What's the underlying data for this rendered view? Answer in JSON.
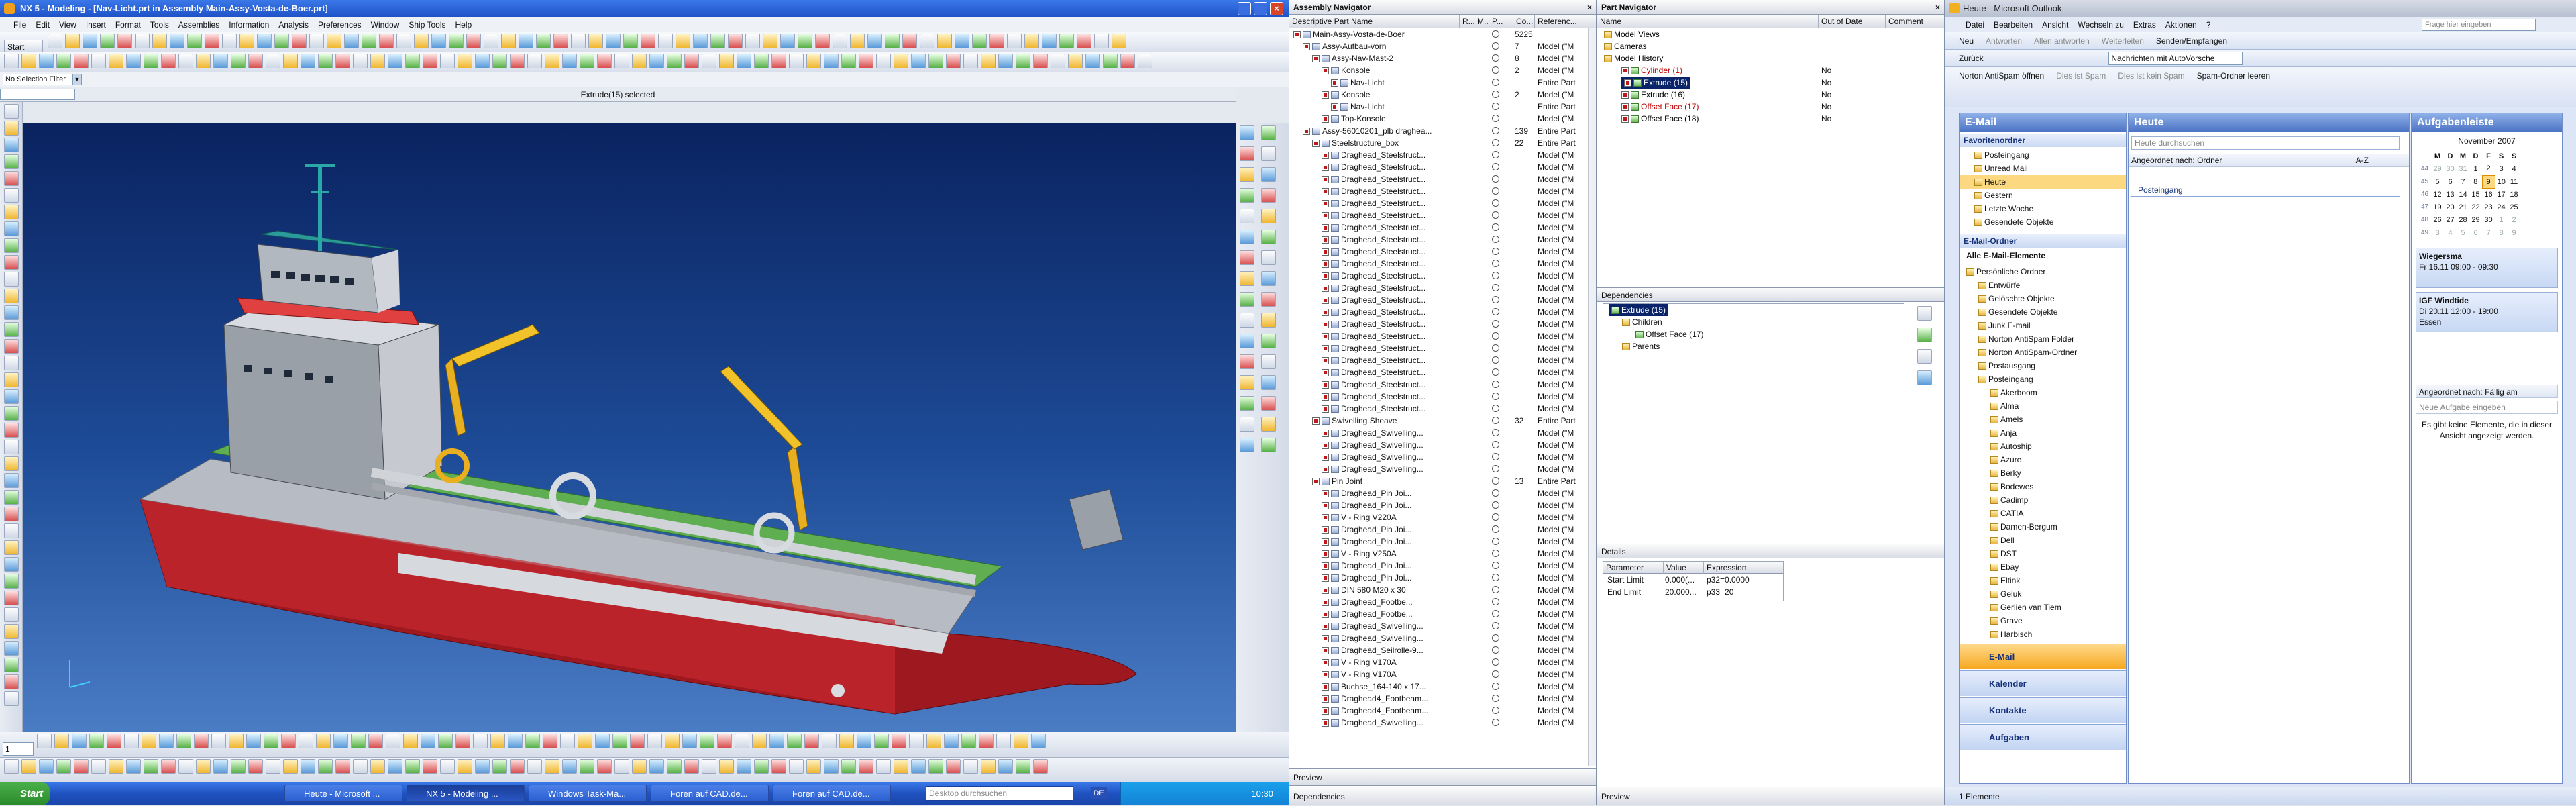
{
  "nx": {
    "title": "NX 5 - Modeling - [Nav-Licht.prt in Assembly Main-Assy-Vosta-de-Boer.prt]",
    "menu": [
      "File",
      "Edit",
      "View",
      "Insert",
      "Format",
      "Tools",
      "Assemblies",
      "Information",
      "Analysis",
      "Preferences",
      "Window",
      "Ship Tools",
      "Help"
    ],
    "start_label": "Start",
    "selection_filter": "No Selection Filter",
    "status": "Extrude(15) selected",
    "view_name": "1"
  },
  "assembly_nav": {
    "title": "Assembly Navigator",
    "columns": [
      "Descriptive Part Name",
      "R...",
      "M...",
      "P...",
      "Co...",
      "Referenc..."
    ],
    "rows": [
      {
        "indent": 0,
        "name": "Main-Assy-Vosta-de-Boer",
        "count": "5225",
        "ref": ""
      },
      {
        "indent": 1,
        "name": "Assy-Aufbau-vorn",
        "count": "7",
        "ref": "Model (\"M"
      },
      {
        "indent": 2,
        "name": "Assy-Nav-Mast-2",
        "count": "8",
        "ref": "Model (\"M"
      },
      {
        "indent": 3,
        "name": "Konsole",
        "count": "2",
        "ref": "Model (\"M"
      },
      {
        "indent": 4,
        "name": "Nav-Licht",
        "count": "",
        "ref": "Entire Part"
      },
      {
        "indent": 3,
        "name": "Konsole",
        "count": "2",
        "ref": "Model (\"M"
      },
      {
        "indent": 4,
        "name": "Nav-Licht",
        "count": "",
        "ref": "Entire Part"
      },
      {
        "indent": 3,
        "name": "Top-Konsole",
        "count": "",
        "ref": "Model (\"M"
      },
      {
        "indent": 1,
        "name": "Assy-56010201_plb draghea...",
        "count": "139",
        "ref": "Entire Part"
      },
      {
        "indent": 2,
        "name": "Steelstructure_box",
        "count": "22",
        "ref": "Entire Part"
      },
      {
        "indent": 3,
        "name": "Draghead_Steelstruct...",
        "count": "",
        "ref": "Model (\"M"
      },
      {
        "indent": 3,
        "name": "Draghead_Steelstruct...",
        "count": "",
        "ref": "Model (\"M"
      },
      {
        "indent": 3,
        "name": "Draghead_Steelstruct...",
        "count": "",
        "ref": "Model (\"M"
      },
      {
        "indent": 3,
        "name": "Draghead_Steelstruct...",
        "count": "",
        "ref": "Model (\"M"
      },
      {
        "indent": 3,
        "name": "Draghead_Steelstruct...",
        "count": "",
        "ref": "Model (\"M"
      },
      {
        "indent": 3,
        "name": "Draghead_Steelstruct...",
        "count": "",
        "ref": "Model (\"M"
      },
      {
        "indent": 3,
        "name": "Draghead_Steelstruct...",
        "count": "",
        "ref": "Model (\"M"
      },
      {
        "indent": 3,
        "name": "Draghead_Steelstruct...",
        "count": "",
        "ref": "Model (\"M"
      },
      {
        "indent": 3,
        "name": "Draghead_Steelstruct...",
        "count": "",
        "ref": "Model (\"M"
      },
      {
        "indent": 3,
        "name": "Draghead_Steelstruct...",
        "count": "",
        "ref": "Model (\"M"
      },
      {
        "indent": 3,
        "name": "Draghead_Steelstruct...",
        "count": "",
        "ref": "Model (\"M"
      },
      {
        "indent": 3,
        "name": "Draghead_Steelstruct...",
        "count": "",
        "ref": "Model (\"M"
      },
      {
        "indent": 3,
        "name": "Draghead_Steelstruct...",
        "count": "",
        "ref": "Model (\"M"
      },
      {
        "indent": 3,
        "name": "Draghead_Steelstruct...",
        "count": "",
        "ref": "Model (\"M"
      },
      {
        "indent": 3,
        "name": "Draghead_Steelstruct...",
        "count": "",
        "ref": "Model (\"M"
      },
      {
        "indent": 3,
        "name": "Draghead_Steelstruct...",
        "count": "",
        "ref": "Model (\"M"
      },
      {
        "indent": 3,
        "name": "Draghead_Steelstruct...",
        "count": "",
        "ref": "Model (\"M"
      },
      {
        "indent": 3,
        "name": "Draghead_Steelstruct...",
        "count": "",
        "ref": "Model (\"M"
      },
      {
        "indent": 3,
        "name": "Draghead_Steelstruct...",
        "count": "",
        "ref": "Model (\"M"
      },
      {
        "indent": 3,
        "name": "Draghead_Steelstruct...",
        "count": "",
        "ref": "Model (\"M"
      },
      {
        "indent": 3,
        "name": "Draghead_Steelstruct...",
        "count": "",
        "ref": "Model (\"M"
      },
      {
        "indent": 3,
        "name": "Draghead_Steelstruct...",
        "count": "",
        "ref": "Model (\"M"
      },
      {
        "indent": 2,
        "name": "Swivelling Sheave",
        "count": "32",
        "ref": "Entire Part"
      },
      {
        "indent": 3,
        "name": "Draghead_Swivelling...",
        "count": "",
        "ref": "Model (\"M"
      },
      {
        "indent": 3,
        "name": "Draghead_Swivelling...",
        "count": "",
        "ref": "Model (\"M"
      },
      {
        "indent": 3,
        "name": "Draghead_Swivelling...",
        "count": "",
        "ref": "Model (\"M"
      },
      {
        "indent": 3,
        "name": "Draghead_Swivelling...",
        "count": "",
        "ref": "Model (\"M"
      },
      {
        "indent": 2,
        "name": "Pin Joint",
        "count": "13",
        "ref": "Entire Part"
      },
      {
        "indent": 3,
        "name": "Draghead_Pin Joi...",
        "count": "",
        "ref": "Model (\"M"
      },
      {
        "indent": 3,
        "name": "Draghead_Pin Joi...",
        "count": "",
        "ref": "Model (\"M"
      },
      {
        "indent": 3,
        "name": "V - Ring V220A",
        "count": "",
        "ref": "Model (\"M"
      },
      {
        "indent": 3,
        "name": "Draghead_Pin Joi...",
        "count": "",
        "ref": "Model (\"M"
      },
      {
        "indent": 3,
        "name": "Draghead_Pin Joi...",
        "count": "",
        "ref": "Model (\"M"
      },
      {
        "indent": 3,
        "name": "V - Ring V250A",
        "count": "",
        "ref": "Model (\"M"
      },
      {
        "indent": 3,
        "name": "Draghead_Pin Joi...",
        "count": "",
        "ref": "Model (\"M"
      },
      {
        "indent": 3,
        "name": "Draghead_Pin Joi...",
        "count": "",
        "ref": "Model (\"M"
      },
      {
        "indent": 3,
        "name": "DIN 580 M20 x 30",
        "count": "",
        "ref": "Model (\"M"
      },
      {
        "indent": 3,
        "name": "Draghead_Footbe...",
        "count": "",
        "ref": "Model (\"M"
      },
      {
        "indent": 3,
        "name": "Draghead_Footbe...",
        "count": "",
        "ref": "Model (\"M"
      },
      {
        "indent": 3,
        "name": "Draghead_Swivelling...",
        "count": "",
        "ref": "Model (\"M"
      },
      {
        "indent": 3,
        "name": "Draghead_Swivelling...",
        "count": "",
        "ref": "Model (\"M"
      },
      {
        "indent": 3,
        "name": "Draghead_Seilrolle-9...",
        "count": "",
        "ref": "Model (\"M"
      },
      {
        "indent": 3,
        "name": "V - Ring V170A",
        "count": "",
        "ref": "Model (\"M"
      },
      {
        "indent": 3,
        "name": "V - Ring V170A",
        "count": "",
        "ref": "Model (\"M"
      },
      {
        "indent": 3,
        "name": "Buchse_164-140 x 17...",
        "count": "",
        "ref": "Model (\"M"
      },
      {
        "indent": 3,
        "name": "Draghead4_Footbeam...",
        "count": "",
        "ref": "Model (\"M"
      },
      {
        "indent": 3,
        "name": "Draghead4_Footbeam...",
        "count": "",
        "ref": "Model (\"M"
      },
      {
        "indent": 3,
        "name": "Draghead_Swivelling...",
        "count": "",
        "ref": "Model (\"M"
      }
    ],
    "preview_label": "Preview",
    "dependencies_label": "Dependencies"
  },
  "part_nav": {
    "title": "Part Navigator",
    "columns": [
      "Name",
      "Out of Date",
      "Comment"
    ],
    "rows": [
      {
        "indent": 0,
        "name": "Model Views",
        "ood": "",
        "color": "#000000"
      },
      {
        "indent": 0,
        "name": "Cameras",
        "ood": "",
        "color": "#000000"
      },
      {
        "indent": 0,
        "name": "Model History",
        "ood": "",
        "color": "#000000"
      },
      {
        "indent": 1,
        "name": "Cylinder (1)",
        "ood": "No",
        "color": "#c00000"
      },
      {
        "indent": 1,
        "name": "Extrude (15)",
        "ood": "No",
        "color": "#ffffff",
        "selected": true
      },
      {
        "indent": 1,
        "name": "Extrude (16)",
        "ood": "No",
        "color": "#000000"
      },
      {
        "indent": 1,
        "name": "Offset Face (17)",
        "ood": "No",
        "color": "#c00000"
      },
      {
        "indent": 1,
        "name": "Offset Face (18)",
        "ood": "No",
        "color": "#000000"
      }
    ],
    "dependencies_title": "Dependencies",
    "dep_rows": [
      {
        "indent": 0,
        "name": "Extrude (15)",
        "selected": true
      },
      {
        "indent": 1,
        "name": "Children"
      },
      {
        "indent": 2,
        "name": "Offset Face (17)"
      },
      {
        "indent": 1,
        "name": "Parents"
      }
    ],
    "details_title": "Details",
    "details_cols": [
      "Parameter",
      "Value",
      "Expression"
    ],
    "details_rows": [
      {
        "p": "Start Limit",
        "v": "0.000(...",
        "e": "p32=0.0000"
      },
      {
        "p": "End Limit",
        "v": "20.000...",
        "e": "p33=20"
      }
    ],
    "preview_label": "Preview"
  },
  "outlook": {
    "title": "Heute - Microsoft Outlook",
    "menu": [
      "Datei",
      "Bearbeiten",
      "Ansicht",
      "Wechseln zu",
      "Extras",
      "Aktionen",
      "?"
    ],
    "help_placeholder": "Frage hier eingeben",
    "toolbar1": [
      "Neu",
      "Antworten",
      "Allen antworten",
      "Weiterleiten",
      "Senden/Empfangen"
    ],
    "toolbar2": {
      "back": "Zurück",
      "combo": "Nachrichten mit AutoVorsche"
    },
    "toolbar3": [
      "Norton AntiSpam öffnen",
      "Dies ist Spam",
      "Dies ist kein Spam",
      "Spam-Ordner leeren"
    ],
    "email_header": "E-Mail",
    "fav_title": "Favoritenordner",
    "favorites": [
      "Posteingang",
      "Unread Mail",
      "Heute",
      "Gestern",
      "Letzte Woche",
      "Gesendete Objekte"
    ],
    "mail_folders_title": "E-Mail-Ordner",
    "all_items": "Alle E-Mail-Elemente",
    "folders": [
      {
        "indent": 0,
        "name": "Persönliche Ordner"
      },
      {
        "indent": 1,
        "name": "Entwürfe"
      },
      {
        "indent": 1,
        "name": "Gelöschte Objekte"
      },
      {
        "indent": 1,
        "name": "Gesendete Objekte"
      },
      {
        "indent": 1,
        "name": "Junk E-mail"
      },
      {
        "indent": 1,
        "name": "Norton AntiSpam Folder"
      },
      {
        "indent": 1,
        "name": "Norton AntiSpam-Ordner"
      },
      {
        "indent": 1,
        "name": "Postausgang"
      },
      {
        "indent": 1,
        "name": "Posteingang"
      },
      {
        "indent": 2,
        "name": "Akerboom"
      },
      {
        "indent": 2,
        "name": "Alma"
      },
      {
        "indent": 2,
        "name": "Amels"
      },
      {
        "indent": 2,
        "name": "Anja"
      },
      {
        "indent": 2,
        "name": "Autoship"
      },
      {
        "indent": 2,
        "name": "Azure"
      },
      {
        "indent": 2,
        "name": "Berky"
      },
      {
        "indent": 2,
        "name": "Bodewes"
      },
      {
        "indent": 2,
        "name": "Cadimp"
      },
      {
        "indent": 2,
        "name": "CATIA"
      },
      {
        "indent": 2,
        "name": "Damen-Bergum"
      },
      {
        "indent": 2,
        "name": "Dell"
      },
      {
        "indent": 2,
        "name": "DST"
      },
      {
        "indent": 2,
        "name": "Ebay"
      },
      {
        "indent": 2,
        "name": "Eltink"
      },
      {
        "indent": 2,
        "name": "Geluk"
      },
      {
        "indent": 2,
        "name": "Gerlien van Tiem"
      },
      {
        "indent": 2,
        "name": "Grave"
      },
      {
        "indent": 2,
        "name": "Harbisch"
      }
    ],
    "nav_buttons": [
      "E-Mail",
      "Kalender",
      "Kontakte",
      "Aufgaben"
    ],
    "today_header": "Heute",
    "search_placeholder": "Heute durchsuchen",
    "sort_label": "Angeordnet nach: Ordner",
    "sort_order": "A-Z",
    "group_item": "Posteingang",
    "status_count": "1 Elemente",
    "tasks_header": "Aufgabenleiste",
    "calendar": {
      "month": "November 2007",
      "weekdays": [
        "M",
        "D",
        "M",
        "D",
        "F",
        "S",
        "S"
      ],
      "weeks": [
        {
          "wk": "44",
          "days": [
            "29",
            "30",
            "31",
            "1",
            "2",
            "3",
            "4"
          ]
        },
        {
          "wk": "45",
          "days": [
            "5",
            "6",
            "7",
            "8",
            "9",
            "10",
            "11"
          ]
        },
        {
          "wk": "46",
          "days": [
            "12",
            "13",
            "14",
            "15",
            "16",
            "17",
            "18"
          ]
        },
        {
          "wk": "47",
          "days": [
            "19",
            "20",
            "21",
            "22",
            "23",
            "24",
            "25"
          ]
        },
        {
          "wk": "48",
          "days": [
            "26",
            "27",
            "28",
            "29",
            "30",
            "1",
            "2"
          ]
        },
        {
          "wk": "49",
          "days": [
            "3",
            "4",
            "5",
            "6",
            "7",
            "8",
            "9"
          ]
        }
      ],
      "today": "9"
    },
    "appointments": [
      {
        "title": "Wiegersma",
        "line2": "Fr 16.11 09:00 - 09:30",
        "line3": ""
      },
      {
        "title": "IGF Windtide",
        "line2": "Di 20.11 12:00 - 19:00",
        "line3": "Essen"
      }
    ],
    "tasks_sort": "Angeordnet nach: Fällig am",
    "new_task_placeholder": "Neue Aufgabe eingeben",
    "no_items_msg": "Es gibt keine Elemente, die in dieser Ansicht angezeigt werden."
  },
  "taskbar": {
    "start": "Start",
    "buttons": [
      "Heute - Microsoft ...",
      "NX 5 - Modeling ...",
      "Windows Task-Ma...",
      "Foren auf CAD.de...",
      "Foren auf CAD.de..."
    ],
    "search_placeholder": "Desktop durchsuchen",
    "clock": "10:30",
    "lang": "DE"
  },
  "colors": {
    "xp_blue": "#2a5fd0",
    "nx_viewport_top": "#0c2a6a",
    "nx_viewport_bottom": "#3f6fb8",
    "hull_red": "#b8202a",
    "selection": "#0a246a"
  }
}
